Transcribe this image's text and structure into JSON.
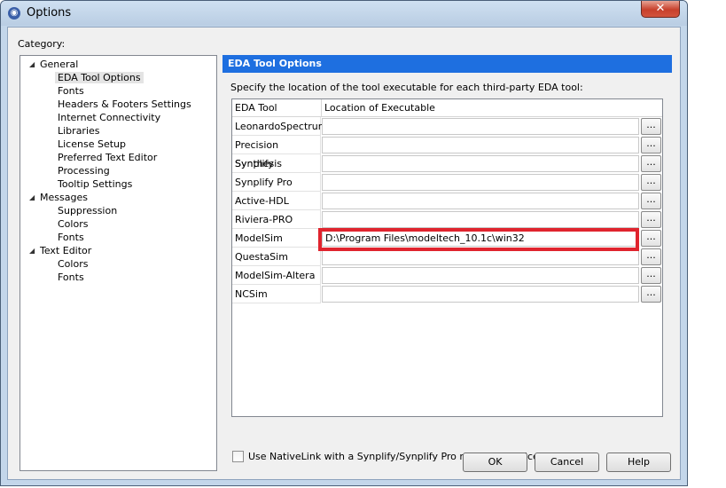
{
  "window": {
    "title": "Options",
    "close_label": "✕"
  },
  "category_label": "Category:",
  "tree": [
    {
      "label": "General",
      "level": 0,
      "expanded": true
    },
    {
      "label": "EDA Tool Options",
      "level": 1,
      "selected": true
    },
    {
      "label": "Fonts",
      "level": 1
    },
    {
      "label": "Headers & Footers Settings",
      "level": 1
    },
    {
      "label": "Internet Connectivity",
      "level": 1
    },
    {
      "label": "Libraries",
      "level": 1
    },
    {
      "label": "License Setup",
      "level": 1
    },
    {
      "label": "Preferred Text Editor",
      "level": 1
    },
    {
      "label": "Processing",
      "level": 1
    },
    {
      "label": "Tooltip Settings",
      "level": 1
    },
    {
      "label": "Messages",
      "level": 0,
      "expanded": true
    },
    {
      "label": "Suppression",
      "level": 1
    },
    {
      "label": "Colors",
      "level": 1
    },
    {
      "label": "Fonts",
      "level": 1
    },
    {
      "label": "Text Editor",
      "level": 0,
      "expanded": true
    },
    {
      "label": "Colors",
      "level": 1
    },
    {
      "label": "Fonts",
      "level": 1
    }
  ],
  "panel": {
    "header": "EDA Tool Options",
    "instruction": "Specify the location of the tool executable for each third-party EDA tool:",
    "columns": {
      "tool": "EDA Tool",
      "location": "Location of Executable"
    },
    "browse_label": "...",
    "rows": [
      {
        "tool": "LeonardoSpectrum",
        "path": ""
      },
      {
        "tool": "Precision Synthesis",
        "path": ""
      },
      {
        "tool": "Synplify",
        "path": ""
      },
      {
        "tool": "Synplify Pro",
        "path": ""
      },
      {
        "tool": "Active-HDL",
        "path": ""
      },
      {
        "tool": "Riviera-PRO",
        "path": ""
      },
      {
        "tool": "ModelSim",
        "path": "D:\\Program Files\\modeltech_10.1c\\win32"
      },
      {
        "tool": "QuestaSim",
        "path": ""
      },
      {
        "tool": "ModelSim-Altera",
        "path": ""
      },
      {
        "tool": "NCSim",
        "path": ""
      }
    ],
    "nativelink_checkbox": {
      "label": "Use NativeLink with a Synplify/Synplify Pro node-locked license",
      "checked": false
    }
  },
  "buttons": {
    "ok": "OK",
    "cancel": "Cancel",
    "help": "Help"
  },
  "colors": {
    "header_blue": "#1e6fe0",
    "highlight_red": "#e0242e"
  }
}
